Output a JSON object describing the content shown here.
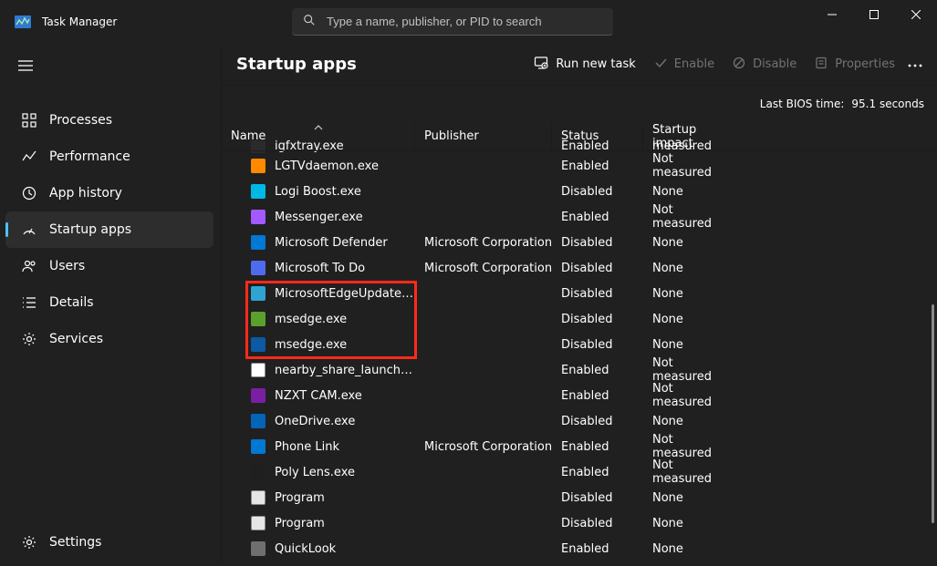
{
  "app": {
    "title": "Task Manager"
  },
  "search": {
    "placeholder": "Type a name, publisher, or PID to search"
  },
  "sidebar": {
    "items": [
      {
        "label": "Processes"
      },
      {
        "label": "Performance"
      },
      {
        "label": "App history"
      },
      {
        "label": "Startup apps"
      },
      {
        "label": "Users"
      },
      {
        "label": "Details"
      },
      {
        "label": "Services"
      }
    ],
    "settings_label": "Settings"
  },
  "page": {
    "title": "Startup apps",
    "run_new_task": "Run new task",
    "enable": "Enable",
    "disable": "Disable",
    "properties": "Properties"
  },
  "info": {
    "label": "Last BIOS time:",
    "value": "95.1 seconds"
  },
  "columns": {
    "name": "Name",
    "publisher": "Publisher",
    "status": "Status",
    "impact": "Startup impact"
  },
  "rows": [
    {
      "name": "igfxtray.exe",
      "publisher": "",
      "status": "Enabled",
      "impact": "Not measured",
      "icon_bg": "#2b2b2b"
    },
    {
      "name": "LGTVdaemon.exe",
      "publisher": "",
      "status": "Enabled",
      "impact": "Not measured",
      "icon_bg": "#ff8a00"
    },
    {
      "name": "Logi Boost.exe",
      "publisher": "",
      "status": "Disabled",
      "impact": "None",
      "icon_bg": "#00b8e6"
    },
    {
      "name": "Messenger.exe",
      "publisher": "",
      "status": "Enabled",
      "impact": "Not measured",
      "icon_bg": "#a259ff"
    },
    {
      "name": "Microsoft Defender",
      "publisher": "Microsoft Corporation",
      "status": "Disabled",
      "impact": "None",
      "icon_bg": "#0078d4"
    },
    {
      "name": "Microsoft To Do",
      "publisher": "Microsoft Corporation",
      "status": "Disabled",
      "impact": "None",
      "icon_bg": "#4f6bed"
    },
    {
      "name": "MicrosoftEdgeUpdateCore...",
      "publisher": "",
      "status": "Disabled",
      "impact": "None",
      "icon_bg": "#2fa3d1"
    },
    {
      "name": "msedge.exe",
      "publisher": "",
      "status": "Disabled",
      "impact": "None",
      "icon_bg": "#5aa02c"
    },
    {
      "name": "msedge.exe",
      "publisher": "",
      "status": "Disabled",
      "impact": "None",
      "icon_bg": "#0c59a4"
    },
    {
      "name": "nearby_share_launcher.exe",
      "publisher": "",
      "status": "Enabled",
      "impact": "Not measured",
      "icon_bg": "#ffffff"
    },
    {
      "name": "NZXT CAM.exe",
      "publisher": "",
      "status": "Enabled",
      "impact": "Not measured",
      "icon_bg": "#7a1fa2"
    },
    {
      "name": "OneDrive.exe",
      "publisher": "",
      "status": "Disabled",
      "impact": "None",
      "icon_bg": "#0364b8"
    },
    {
      "name": "Phone Link",
      "publisher": "Microsoft Corporation",
      "status": "Enabled",
      "impact": "Not measured",
      "icon_bg": "#0078d4"
    },
    {
      "name": "Poly Lens.exe",
      "publisher": "",
      "status": "Enabled",
      "impact": "Not measured",
      "icon_bg": "#1f1f1f"
    },
    {
      "name": "Program",
      "publisher": "",
      "status": "Disabled",
      "impact": "None",
      "icon_bg": "#e6e6e6"
    },
    {
      "name": "Program",
      "publisher": "",
      "status": "Disabled",
      "impact": "None",
      "icon_bg": "#e6e6e6"
    },
    {
      "name": "QuickLook",
      "publisher": "",
      "status": "Enabled",
      "impact": "None",
      "icon_bg": "#6f6f6f"
    }
  ],
  "highlight": {
    "row_start": 6,
    "row_end": 8
  }
}
